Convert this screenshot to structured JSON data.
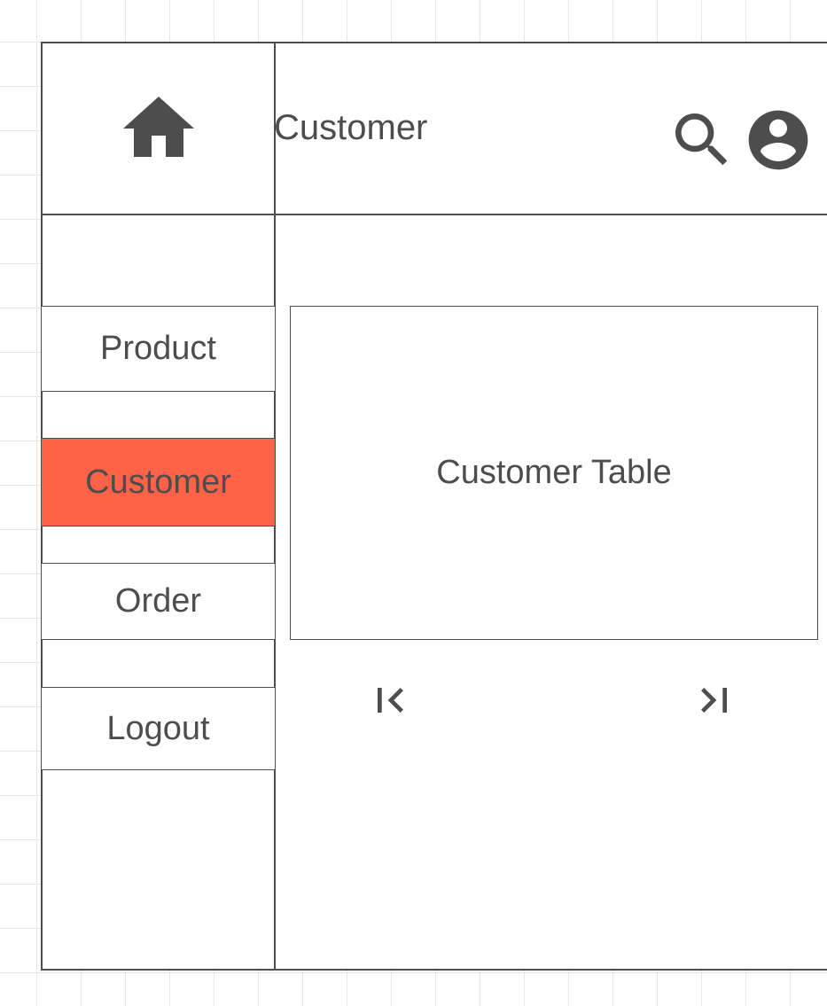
{
  "header": {
    "title": "Customer"
  },
  "icons": {
    "home": "home-icon",
    "search": "search-icon",
    "user": "account-circle-icon",
    "first_page": "first-page-icon",
    "last_page": "last-page-icon"
  },
  "sidebar": {
    "items": [
      {
        "label": "Product",
        "active": false
      },
      {
        "label": "Customer",
        "active": true
      },
      {
        "label": "Order",
        "active": false
      },
      {
        "label": "Logout",
        "active": false
      }
    ]
  },
  "main": {
    "table_placeholder": "Customer Table"
  },
  "colors": {
    "active_item": "#ff6347",
    "stroke": "#4d4d4d",
    "grid": "#e6e6e6"
  }
}
